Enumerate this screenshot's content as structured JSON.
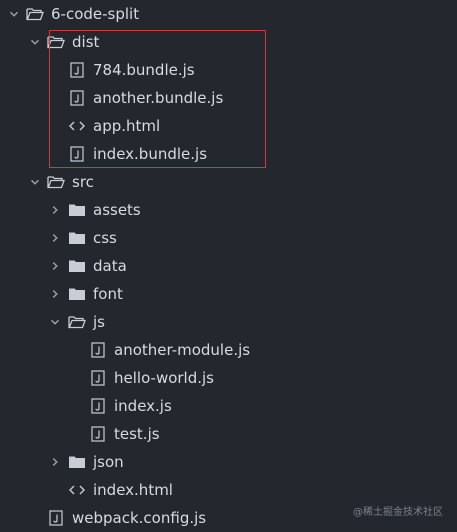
{
  "explorer": {
    "root": {
      "label": "6-code-split",
      "expanded": true
    },
    "dist": {
      "label": "dist",
      "expanded": true,
      "files": [
        "784.bundle.js",
        "another.bundle.js",
        "app.html",
        "index.bundle.js"
      ]
    },
    "src": {
      "label": "src",
      "expanded": true,
      "folders": [
        "assets",
        "css",
        "data",
        "font"
      ],
      "js": {
        "label": "js",
        "expanded": true,
        "files": [
          "another-module.js",
          "hello-world.js",
          "index.js",
          "test.js"
        ]
      },
      "json": {
        "label": "json"
      },
      "index_html": "index.html"
    },
    "webpack_config": "webpack.config.js"
  },
  "highlight": {
    "target": "dist",
    "border_color": "#c83d3f"
  },
  "watermark": "@稀土掘金技术社区",
  "icons": {
    "chevron_expanded": "chevron-down-icon",
    "chevron_collapsed": "chevron-right-icon",
    "folder_open": "folder-open-icon",
    "folder_closed": "folder-icon",
    "js_file": "js-file-icon",
    "html_file": "html-file-icon"
  },
  "colors": {
    "background": "#24272e",
    "text": "#d7dae0",
    "icon": "#c8ccd4",
    "chevron": "#9da2ad"
  }
}
